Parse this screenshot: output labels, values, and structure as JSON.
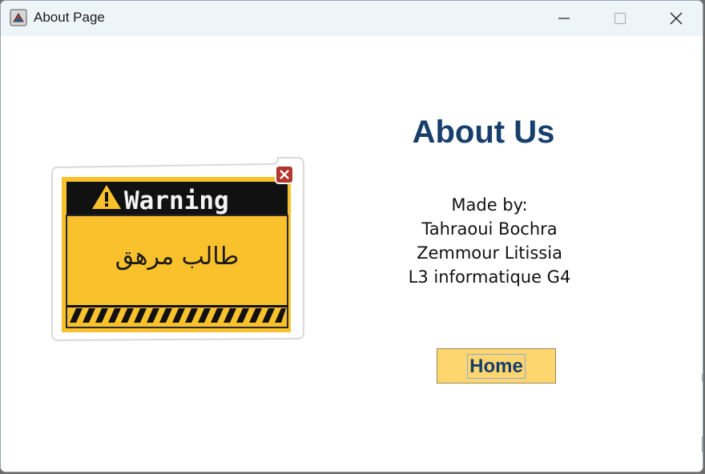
{
  "window": {
    "title": "About Page",
    "controls": {
      "minimize": "minimize-icon",
      "maximize": "maximize-icon",
      "close": "close-icon"
    }
  },
  "sticker": {
    "heading": "Warning",
    "arabic_text": "طالب مرهق",
    "icons": [
      "warning-triangle-icon",
      "close-icon"
    ],
    "colors": {
      "panel": "#f9c12b",
      "header": "#111111",
      "close_badge": "#b3362f"
    }
  },
  "about": {
    "title": "About Us",
    "made_by_label": "Made by:",
    "authors": [
      "Tahraoui Bochra",
      "Zemmour Litissia"
    ],
    "group": "L3 informatique G4"
  },
  "home_button": {
    "label": "Home"
  },
  "colors": {
    "title": "#173f6b",
    "button_bg": "#fed66f",
    "titlebar": "#eef5f8"
  }
}
